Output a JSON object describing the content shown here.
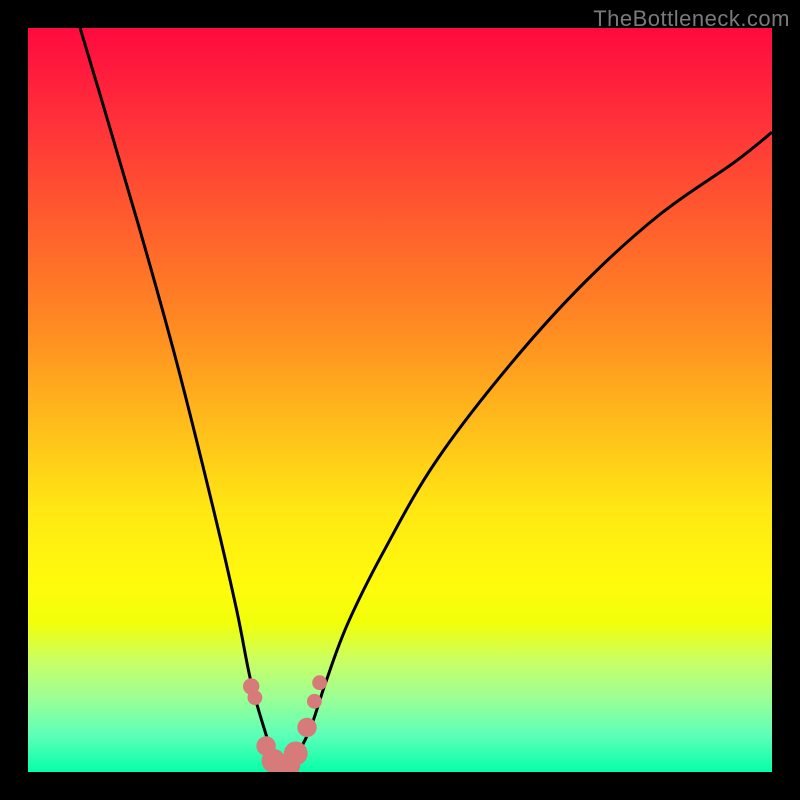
{
  "watermark": {
    "text": "TheBottleneck.com"
  },
  "colors": {
    "bg": "#000000",
    "curve": "#000000",
    "marker": "#d67a7a",
    "gradient_stops": [
      {
        "pos": 0,
        "hex": "#ff0a3f"
      },
      {
        "pos": 12,
        "hex": "#ff2f3a"
      },
      {
        "pos": 25,
        "hex": "#ff5a2e"
      },
      {
        "pos": 40,
        "hex": "#ff8a22"
      },
      {
        "pos": 55,
        "hex": "#ffc31a"
      },
      {
        "pos": 65,
        "hex": "#ffe813"
      },
      {
        "pos": 75,
        "hex": "#fffb0c"
      },
      {
        "pos": 80,
        "hex": "#f1ff0a"
      },
      {
        "pos": 85,
        "hex": "#caff63"
      },
      {
        "pos": 90,
        "hex": "#9cff94"
      },
      {
        "pos": 95,
        "hex": "#5effb8"
      },
      {
        "pos": 100,
        "hex": "#05ffaa"
      }
    ]
  },
  "chart_data": {
    "type": "line",
    "title": "",
    "xlabel": "",
    "ylabel": "",
    "xlim": [
      0,
      100
    ],
    "ylim": [
      0,
      100
    ],
    "series": [
      {
        "name": "bottleneck-curve",
        "x": [
          7,
          10,
          15,
          20,
          25,
          28,
          30,
          32,
          33,
          34,
          35,
          36,
          38,
          40,
          43,
          48,
          55,
          65,
          75,
          85,
          95,
          100
        ],
        "y": [
          100,
          90,
          73,
          55,
          35,
          22,
          12,
          5,
          2,
          0.5,
          0.5,
          2,
          6,
          12,
          20,
          30,
          42,
          55,
          66,
          75,
          82,
          86
        ]
      }
    ],
    "markers": {
      "name": "highlight-dots",
      "x": [
        30.0,
        30.5,
        32.0,
        33.0,
        34.0,
        35.0,
        36.0,
        37.5,
        38.5,
        39.2
      ],
      "y": [
        11.5,
        10.0,
        3.5,
        1.5,
        0.8,
        1.0,
        2.5,
        6.0,
        9.5,
        12.0
      ],
      "r": [
        1.1,
        1.0,
        1.3,
        1.6,
        1.6,
        1.6,
        1.6,
        1.3,
        1.0,
        1.0
      ]
    }
  }
}
